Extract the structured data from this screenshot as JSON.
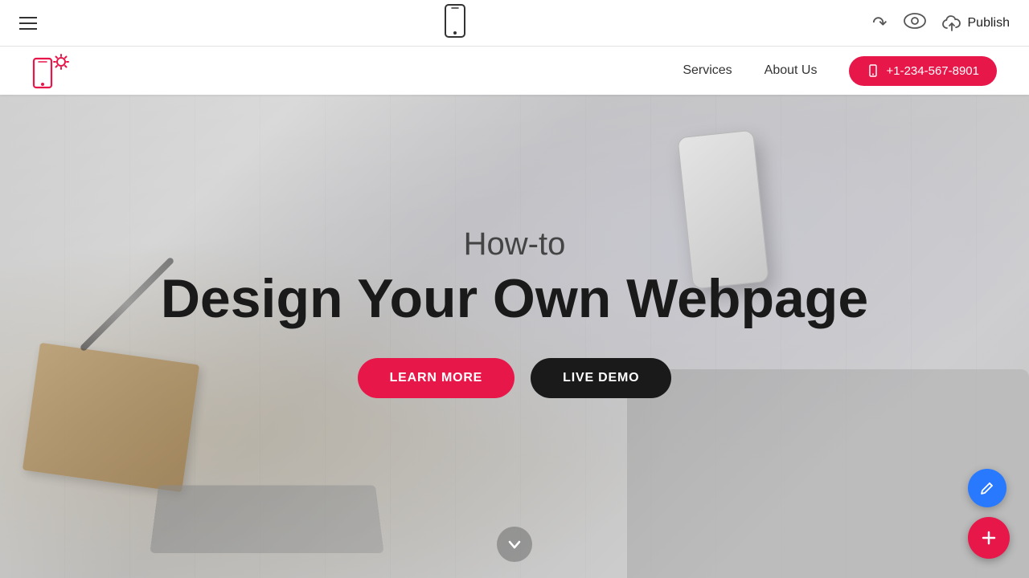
{
  "toolbar": {
    "publish_label": "Publish"
  },
  "site": {
    "nav": {
      "services_label": "Services",
      "about_label": "About Us",
      "phone_number": "+1-234-567-8901"
    },
    "hero": {
      "subtitle": "How-to",
      "title": "Design Your Own Webpage",
      "learn_more_label": "LEARN MORE",
      "live_demo_label": "LIVE DEMO"
    }
  },
  "icons": {
    "hamburger": "☰",
    "mobile_preview": "📱",
    "undo": "↩",
    "eye": "👁",
    "cloud_upload": "☁",
    "phone": "📞",
    "arrow_down": "↓",
    "pencil": "✏",
    "plus": "+"
  },
  "colors": {
    "accent": "#e8174a",
    "dark": "#1a1a1a",
    "fab_blue": "#2979ff"
  }
}
